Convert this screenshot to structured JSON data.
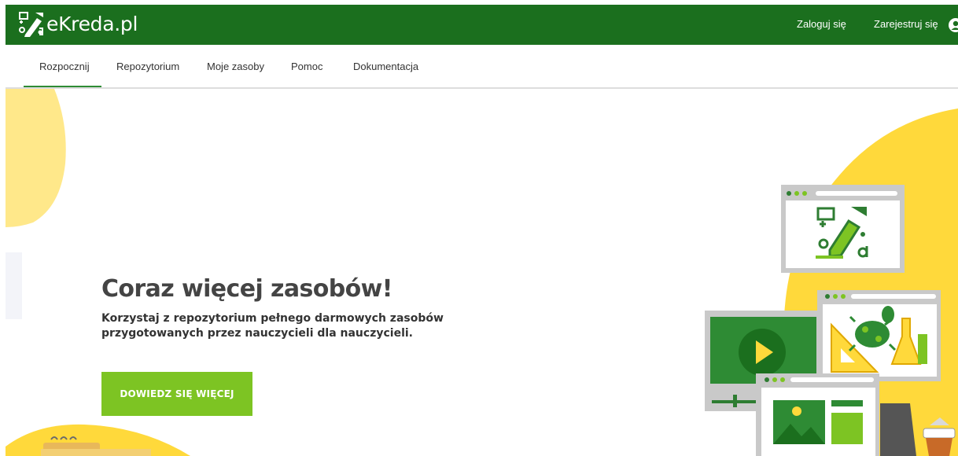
{
  "header": {
    "logo_text": "eKreda.pl",
    "login_label": "Zaloguj się",
    "register_label": "Zarejestruj się"
  },
  "nav": {
    "items": [
      {
        "label": "Rozpocznij",
        "active": true
      },
      {
        "label": "Repozytorium",
        "active": false
      },
      {
        "label": "Moje zasoby",
        "active": false
      },
      {
        "label": "Pomoc",
        "active": false
      },
      {
        "label": "Dokumentacja",
        "active": false
      }
    ]
  },
  "hero": {
    "title": "Coraz więcej zasobów!",
    "subtitle": "Korzystaj z repozytorium pełnego darmowych zasobów przygotowanych przez nauczycieli dla nauczycieli.",
    "button_label": "DOWIEDZ SIĘ WIĘCEJ"
  },
  "icons": {
    "logo": "ekreda-logo-icon",
    "user": "user-account-icon"
  },
  "colors": {
    "header_bg": "#1b6f1e",
    "accent_green": "#7dc423",
    "nav_active": "#2e8b34",
    "yellow": "#ffd93b",
    "light_yellow": "#ffe88a",
    "title_text": "#444444"
  }
}
